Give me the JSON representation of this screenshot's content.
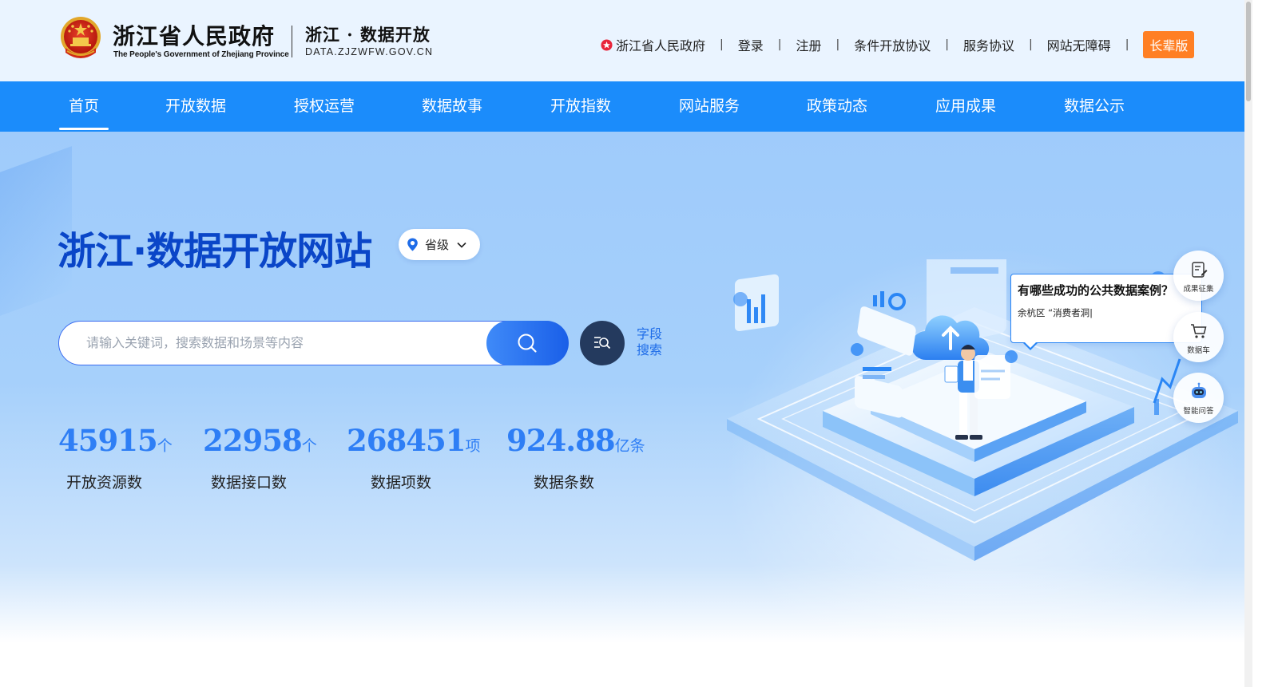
{
  "header": {
    "gov_name_cn": "浙江省人民政府",
    "gov_name_en": "The People's Government of Zhejiang Province",
    "site_name_cn": "浙江 · 数据开放",
    "site_domain": "DATA.ZJZWFW.GOV.CN",
    "links": [
      "浙江省人民政府",
      "登录",
      "注册",
      "条件开放协议",
      "服务协议",
      "网站无障碍"
    ],
    "separator": "|",
    "elder_mode_label": "长辈版"
  },
  "nav": {
    "items": [
      "首页",
      "开放数据",
      "授权运营",
      "数据故事",
      "开放指数",
      "网站服务",
      "政策动态",
      "应用成果",
      "数据公示"
    ],
    "active_index": 0
  },
  "hero": {
    "title": "浙江·数据开放网站",
    "level_select": {
      "value": "省级"
    },
    "search": {
      "placeholder": "请输入关键词，搜索数据和场景等内容",
      "value": ""
    },
    "field_search_label": "字段\n搜索"
  },
  "stats": [
    {
      "value": "45915",
      "unit": "个",
      "label": "开放资源数"
    },
    {
      "value": "22958",
      "unit": "个",
      "label": "数据接口数"
    },
    {
      "value": "268451",
      "unit": "项",
      "label": "数据项数"
    },
    {
      "value": "924.88",
      "unit": "亿条",
      "label": "数据条数"
    }
  ],
  "chat": {
    "question": "有哪些成功的公共数据案例？",
    "answer_typing": "余杭区 “消费者洞|"
  },
  "float_buttons": [
    {
      "label": "成果征集",
      "icon": "edit-document-icon"
    },
    {
      "label": "数据车",
      "icon": "cart-icon"
    },
    {
      "label": "智能问答",
      "icon": "robot-icon"
    }
  ],
  "colors": {
    "nav_bg": "#1b8cfb",
    "title": "#0a46c8",
    "stat_number": "#2e7ef5",
    "elder_button": "#ff7f24",
    "header_bg": "#eaf4ff"
  }
}
